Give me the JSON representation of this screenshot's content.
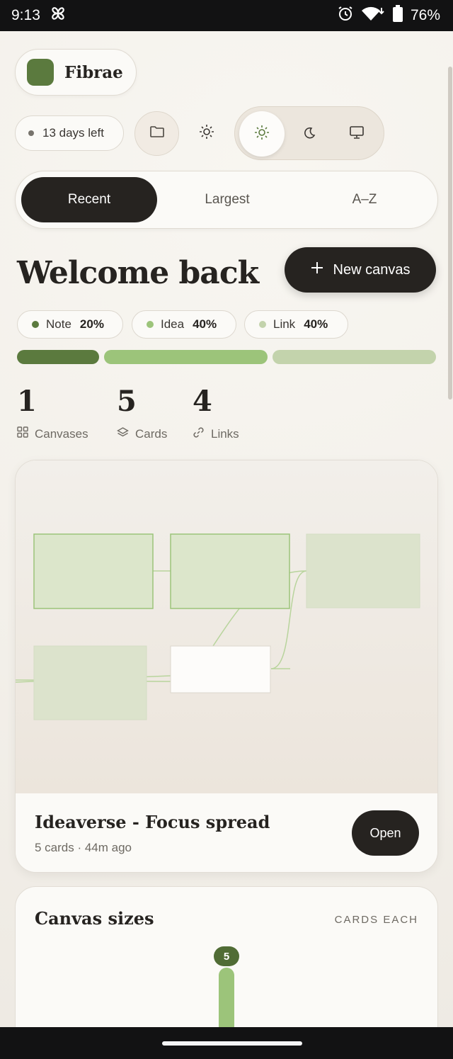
{
  "status_bar": {
    "time": "9:13",
    "battery": "76%"
  },
  "brand": {
    "name": "Fibrae"
  },
  "trial": {
    "label": "13 days left"
  },
  "sort": {
    "tabs": [
      "Recent",
      "Largest",
      "A–Z"
    ],
    "active": "Recent"
  },
  "header": {
    "title": "Welcome back",
    "new_canvas_label": "New canvas"
  },
  "mix": {
    "items": [
      {
        "label": "Note",
        "percent": "20%",
        "color": "#5b7a3e"
      },
      {
        "label": "Idea",
        "percent": "40%",
        "color": "#9cc47a"
      },
      {
        "label": "Link",
        "percent": "40%",
        "color": "#c3d3ac"
      }
    ],
    "fractions": [
      0.2,
      0.4,
      0.4
    ]
  },
  "stats": [
    {
      "value": "1",
      "label": "Canvases",
      "icon": "grid-icon"
    },
    {
      "value": "5",
      "label": "Cards",
      "icon": "layers-icon"
    },
    {
      "value": "4",
      "label": "Links",
      "icon": "link-icon"
    }
  ],
  "canvas_card": {
    "title": "Ideaverse - Focus spread",
    "meta": "5 cards · 44m ago",
    "open_label": "Open"
  },
  "sizes": {
    "title": "Canvas sizes",
    "subtitle": "CARDS EACH",
    "badge": "5"
  },
  "colors": {
    "dark": "#262320",
    "accent": "#5b7a3e",
    "idea": "#9cc47a",
    "link": "#c3d3ac"
  }
}
